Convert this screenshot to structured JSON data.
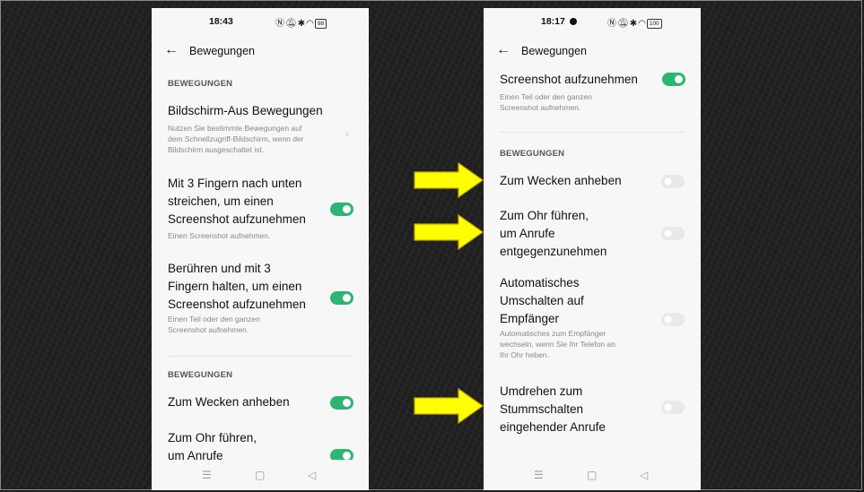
{
  "left": {
    "status": {
      "time": "18:43",
      "battery": "98"
    },
    "appbar": {
      "title": "Bewegungen"
    },
    "section1": "BEWEGUNGEN",
    "item1": {
      "title": "Bildschirm-Aus Bewegungen",
      "subtitle_lines": [
        "Nutzen Sie bestimmte Bewegungen auf",
        "dem Schnellzugriff-Bildschirm, wenn der",
        "Bildschirm ausgeschaltet ist."
      ]
    },
    "item2": {
      "title_lines": [
        "Mit 3 Fingern nach unten",
        "streichen, um einen",
        "Screenshot aufzunehmen"
      ],
      "subtitle": "Einen Screenshot aufnehmen.",
      "toggle": "on"
    },
    "item3": {
      "title_lines": [
        "Berühren und mit 3",
        "Fingern halten, um einen",
        "Screenshot aufzunehmen"
      ],
      "subtitle_lines": [
        "Einen Teil oder den ganzen",
        "Screenshot aufnehmen."
      ],
      "toggle": "on"
    },
    "section2": "BEWEGUNGEN",
    "item4": {
      "title": "Zum Wecken anheben",
      "toggle": "on"
    },
    "item5": {
      "title_lines": [
        "Zum Ohr führen,",
        "um Anrufe"
      ],
      "toggle": "on"
    },
    "nav": {
      "menu": "☰",
      "home": "▢",
      "back": "◁"
    }
  },
  "right": {
    "status": {
      "time": "18:17",
      "battery": "100"
    },
    "appbar": {
      "title": "Bewegungen"
    },
    "item0": {
      "title": "Screenshot aufzunehmen",
      "subtitle_lines": [
        "Einen Teil oder den ganzen",
        "Screenshot aufnehmen."
      ],
      "toggle": "on"
    },
    "section": "BEWEGUNGEN",
    "item1": {
      "title": "Zum Wecken anheben",
      "toggle": "off"
    },
    "item2": {
      "title_lines": [
        "Zum Ohr führen,",
        "um Anrufe",
        "entgegenzunehmen"
      ],
      "toggle": "off"
    },
    "item3": {
      "title_lines": [
        "Automatisches",
        "Umschalten auf",
        "Empfänger"
      ],
      "subtitle_lines": [
        "Automatisches zum Empfänger",
        "wechseln, wenn Sie Ihr Telefon an",
        "Ihr Ohr heben."
      ],
      "toggle": "off"
    },
    "item4": {
      "title_lines": [
        "Umdrehen zum",
        "Stummschalten",
        "eingehender Anrufe"
      ],
      "toggle": "off"
    },
    "nav": {
      "menu": "☰",
      "home": "▢",
      "back": "◁"
    }
  },
  "colors": {
    "toggle_on": "#2bb673",
    "toggle_off": "#e9e9e9",
    "arrow": "#ffff00",
    "arrow_outline": "#c9a800"
  },
  "icons": [
    "back-arrow-icon",
    "nfc-icon",
    "mute-icon",
    "bluetooth-icon",
    "wifi-icon",
    "battery-icon",
    "menu-icon",
    "home-icon",
    "back-icon",
    "chevron-right-icon",
    "arrow-right-icon"
  ]
}
